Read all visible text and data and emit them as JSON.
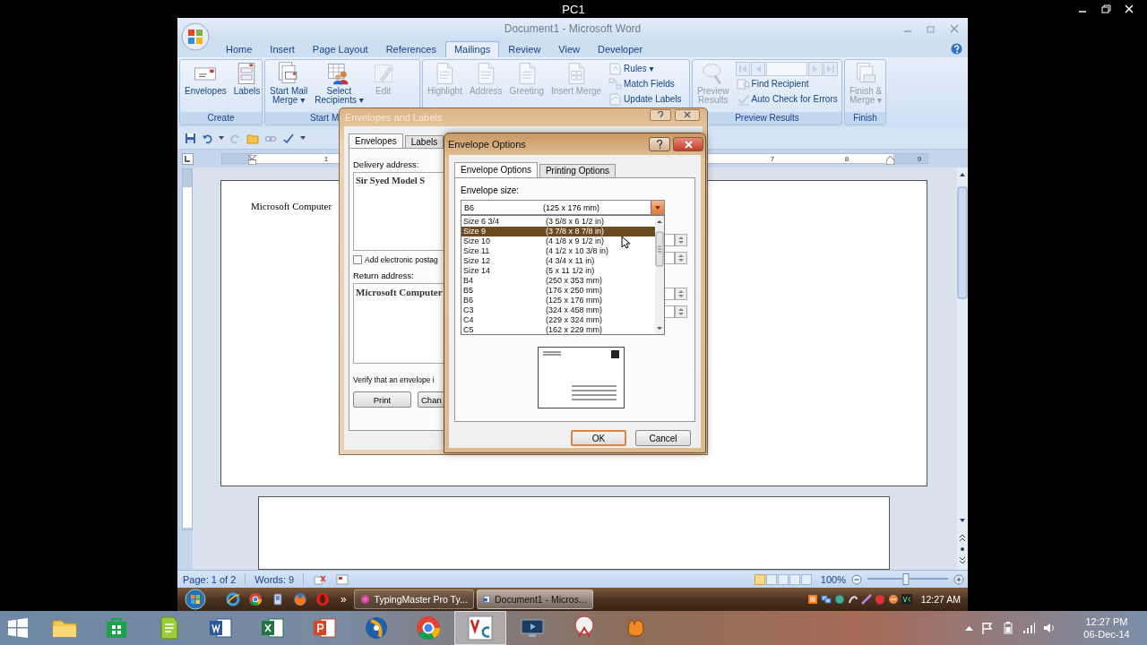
{
  "host": {
    "title": "PC1",
    "apps": [
      {
        "kind": "folder",
        "selected": false
      },
      {
        "kind": "store",
        "selected": false
      },
      {
        "kind": "notes",
        "selected": false
      },
      {
        "kind": "word",
        "selected": false
      },
      {
        "kind": "excel",
        "selected": false
      },
      {
        "kind": "powerpoint",
        "selected": false
      },
      {
        "kind": "media",
        "selected": false
      },
      {
        "kind": "chrome",
        "selected": false
      },
      {
        "kind": "vnc",
        "selected": true
      },
      {
        "kind": "monitor",
        "selected": false
      },
      {
        "kind": "tool",
        "selected": false
      },
      {
        "kind": "glove",
        "selected": false
      }
    ],
    "time": "12:27 PM",
    "date": "06-Dec-14"
  },
  "word": {
    "title": "Document1 - Microsoft Word",
    "tabs": [
      {
        "label": "Home",
        "selected": false
      },
      {
        "label": "Insert",
        "selected": false
      },
      {
        "label": "Page Layout",
        "selected": false
      },
      {
        "label": "References",
        "selected": false
      },
      {
        "label": "Mailings",
        "selected": true
      },
      {
        "label": "Review",
        "selected": false
      },
      {
        "label": "View",
        "selected": false
      },
      {
        "label": "Developer",
        "selected": false
      }
    ],
    "ribbon_groups": [
      {
        "label": "Create",
        "items": [
          {
            "kind": "large",
            "lines": [
              "Envelopes"
            ],
            "disabled": false
          },
          {
            "kind": "large",
            "lines": [
              "Labels"
            ],
            "disabled": false
          }
        ]
      },
      {
        "label": "Start M",
        "items": [
          {
            "kind": "large",
            "lines": [
              "Start Mail",
              "Merge ▾"
            ],
            "disabled": false
          },
          {
            "kind": "large",
            "lines": [
              "Select",
              "Recipients ▾"
            ],
            "disabled": false
          },
          {
            "kind": "large",
            "lines": [
              "Edit"
            ],
            "disabled": true
          }
        ]
      },
      {
        "items": [
          {
            "kind": "large",
            "lines": [
              "Highlight"
            ],
            "disabled": true
          },
          {
            "kind": "large",
            "lines": [
              "Address"
            ],
            "disabled": true
          },
          {
            "kind": "large",
            "lines": [
              "Greeting"
            ],
            "disabled": true
          },
          {
            "kind": "large",
            "lines": [
              "Insert Merge"
            ],
            "disabled": true
          },
          {
            "kind": "stack",
            "rows": [
              {
                "kind": "button",
                "label": "Rules ▾",
                "disabled": true
              },
              {
                "kind": "button",
                "label": "Match Fields",
                "disabled": true
              },
              {
                "kind": "button",
                "label": "Update Labels",
                "disabled": true
              }
            ]
          }
        ]
      },
      {
        "label": "Preview Results",
        "items": [
          {
            "kind": "large",
            "lines": [
              "Preview",
              "Results"
            ],
            "disabled": true
          },
          {
            "kind": "stack",
            "rows": [
              {
                "kind": "nav",
                "disabled": true
              },
              {
                "kind": "button",
                "label": "Find Recipient",
                "disabled": true
              },
              {
                "kind": "button",
                "label": "Auto Check for Errors",
                "disabled": true
              }
            ]
          }
        ]
      },
      {
        "label": "Finish",
        "items": [
          {
            "kind": "large",
            "lines": [
              "Finish &",
              "Merge ▾"
            ],
            "disabled": true
          }
        ]
      }
    ],
    "ruler_numbers": [
      "1",
      "7",
      "8",
      "9"
    ],
    "document_text": "Microsoft Computer",
    "status": {
      "page": "Page: 1 of 2",
      "words": "Words: 9",
      "views": [
        {
          "selected": true
        },
        {
          "selected": false
        },
        {
          "selected": false
        },
        {
          "selected": false
        },
        {
          "selected": false
        }
      ],
      "zoom": "100%",
      "level": 0.48
    }
  },
  "envelopes_dialog": {
    "title": "Envelopes and Labels",
    "tabs": [
      {
        "label": "Envelopes",
        "selected": true
      },
      {
        "label": "Labels",
        "selected": false
      }
    ],
    "delivery_label": "Delivery address:",
    "delivery_address": "Sir Syed Model S",
    "postage": {
      "label": "Add electronic postag",
      "checked": false
    },
    "return_label": "Return address:",
    "return_address": "Microsoft Computer",
    "verify_text": "Verify that an envelope i",
    "buttons": [
      "Print",
      "Chan"
    ]
  },
  "options_dialog": {
    "title": "Envelope Options",
    "tabs": [
      {
        "label": "Envelope Options",
        "selected": true
      },
      {
        "label": "Printing Options",
        "selected": false
      }
    ],
    "size_label": "Envelope size:",
    "size_value": {
      "name": "B6",
      "dims": "(125 x 176 mm)"
    },
    "sizes": [
      {
        "name": "Size 6 3/4",
        "dims": "(3 5/8 x 6 1/2 in)",
        "selected": false
      },
      {
        "name": "Size 9",
        "dims": "(3 7/8 x 8 7/8 in)",
        "selected": true
      },
      {
        "name": "Size 10",
        "dims": "(4 1/8 x 9 1/2 in)",
        "selected": false
      },
      {
        "name": "Size 11",
        "dims": "(4 1/2 x 10 3/8 in)",
        "selected": false
      },
      {
        "name": "Size 12",
        "dims": "(4 3/4 x 11 in)",
        "selected": false
      },
      {
        "name": "Size 14",
        "dims": "(5 x 11 1/2 in)",
        "selected": false
      },
      {
        "name": "B4",
        "dims": "(250 x 353 mm)",
        "selected": false
      },
      {
        "name": "B5",
        "dims": "(176 x 250 mm)",
        "selected": false
      },
      {
        "name": "B6",
        "dims": "(125 x 176 mm)",
        "selected": false
      },
      {
        "name": "C3",
        "dims": "(324 x 458 mm)",
        "selected": false
      },
      {
        "name": "C4",
        "dims": "(229 x 324 mm)",
        "selected": false
      },
      {
        "name": "C5",
        "dims": "(162 x 229 mm)",
        "selected": false
      }
    ],
    "buttons": [
      {
        "label": "OK",
        "default": true
      },
      {
        "label": "Cancel",
        "default": false
      }
    ]
  },
  "remote_taskbar": {
    "quick_launch": [
      {
        "kind": "ie"
      },
      {
        "kind": "chrome"
      },
      {
        "kind": "device"
      },
      {
        "kind": "firefox"
      },
      {
        "kind": "opera"
      }
    ],
    "overflow": "»",
    "tasks": [
      {
        "kind": "typing",
        "label": "TypingMaster Pro Ty...",
        "selected": false
      },
      {
        "kind": "document",
        "label": "Document1 - Micros...",
        "selected": true
      }
    ],
    "time": "12:27 AM"
  }
}
